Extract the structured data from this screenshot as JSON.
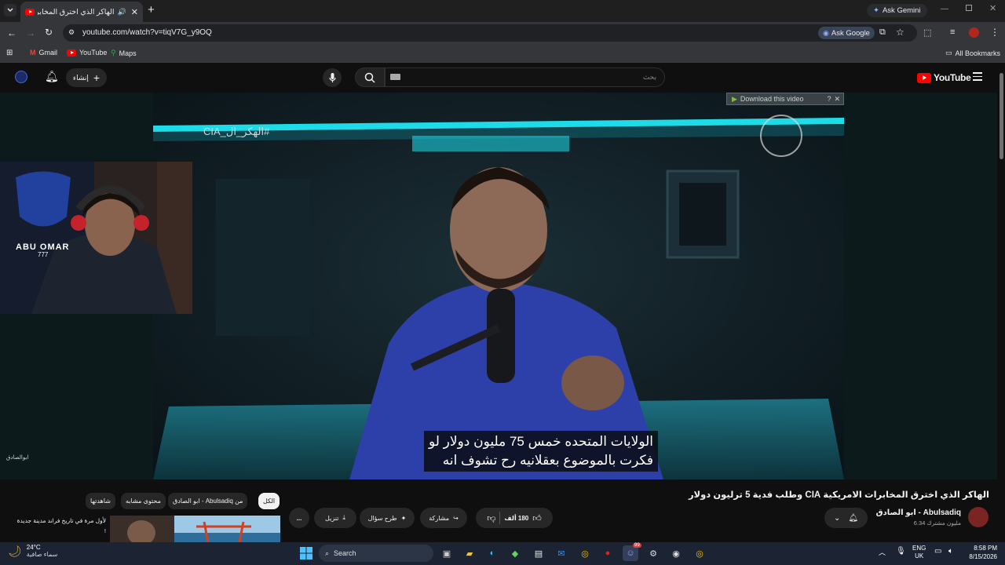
{
  "browser": {
    "tab_title": "الهاكر الذي اخترق المخابرات ال",
    "url": "youtube.com/watch?v=tiqV7G_y9OQ",
    "ask_gemini": "Ask Gemini",
    "ask_google": "Ask Google",
    "bookmarks": [
      "Gmail",
      "YouTube",
      "Maps"
    ],
    "all_bookmarks": "All Bookmarks"
  },
  "youtube": {
    "logo_text": "YouTube",
    "create_label": "إنشاء",
    "search_placeholder": "بحث"
  },
  "video": {
    "hashtag": "#الهكر_ال_CIA",
    "download_label": "Download this video",
    "subtitle_line1": "الولايات المتحده خمس 75 مليون دولار لو",
    "subtitle_line2": "فكرت بالموضوع بعقلانيه رح تشوف انه",
    "webcam_brand": "ABU OMAR",
    "webcam_brand_sub": "777",
    "corner_watermark": "ابوالصادق"
  },
  "details": {
    "title": "الهاكر الذي اخترق المخابرات الامريكية CIA وطلب فدية 5 ترليون دولار",
    "channel": "Abulsadiq - ابو الصادق",
    "subscribers": "6.34 مليون مشترك",
    "likes": "180 ألف",
    "share": "مشاركة",
    "ask": "طرح سؤال",
    "download": "تنزيل",
    "more": "..."
  },
  "chips": [
    {
      "label": "الكل",
      "active": true
    },
    {
      "label": "من Abulsadiq - ابو الصادق",
      "active": false
    },
    {
      "label": "محتوى مشابه",
      "active": false
    },
    {
      "label": "شاهدتها",
      "active": false
    }
  ],
  "recommended": {
    "line1": "لأول مرة في تاريخ فراند مدينة جديدة",
    "line2": "!"
  },
  "taskbar": {
    "weather_temp": "24°C",
    "weather_desc": "سماء صافية",
    "search_label": "Search",
    "lang_top": "ENG",
    "lang_bottom": "UK",
    "time": "8:58 PM",
    "date": "8/15/2026",
    "discord_badge": "99"
  },
  "colors": {
    "accent_red": "#ff0000",
    "video_teal": "#1fe6f2",
    "shirt_blue": "#2d3fa8",
    "taskbar_bg": "#1c2434"
  }
}
